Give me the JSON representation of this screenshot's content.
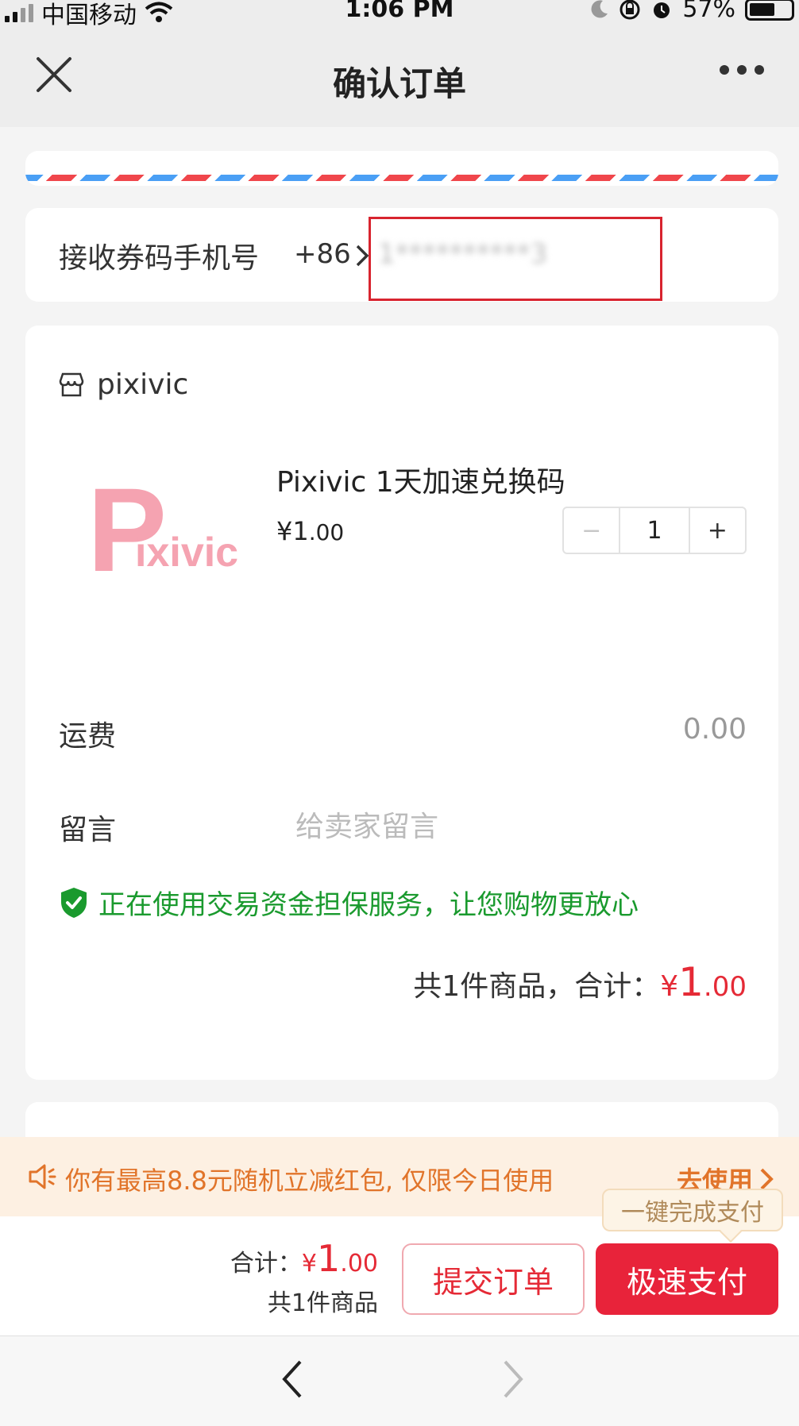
{
  "status_bar": {
    "carrier": "中国移动",
    "time": "1:06 PM",
    "battery": "57%",
    "icons": [
      "signal-icon",
      "wifi-icon",
      "moon-icon",
      "rotation-lock-icon",
      "alarm-icon",
      "battery-icon"
    ]
  },
  "nav": {
    "title": "确认订单",
    "close_icon": "close-icon",
    "more_icon": "more-icon"
  },
  "phone": {
    "label": "接收券码手机号",
    "country_code": "+86",
    "value": "1**********3"
  },
  "shop": {
    "name": "pixivic",
    "icon": "store-icon"
  },
  "product": {
    "title": "Pixivic 1天加速兑换码",
    "price_symbol": "¥",
    "price_int": "1",
    "price_dec": ".00",
    "logo_text_p": "P",
    "logo_text_rest": "ixivic",
    "quantity": "1",
    "minus": "−",
    "plus": "+"
  },
  "shipping": {
    "label": "运费",
    "value": "0.00"
  },
  "message": {
    "label": "留言",
    "placeholder": "给卖家留言"
  },
  "guarantee": {
    "text": "正在使用交易资金担保服务，让您购物更放心",
    "icon": "shield-check-icon"
  },
  "summary": {
    "prefix": "共1件商品，合计：",
    "currency": "¥",
    "amount_int": "1",
    "amount_dec": ".00"
  },
  "promo": {
    "text": "你有最高8.8元随机立减红包, 仅限今日使用",
    "action": "去使用",
    "icon": "speaker-icon"
  },
  "tooltip": {
    "text": "一键完成支付"
  },
  "bottom": {
    "total_label": "合计：",
    "currency": "¥",
    "amount_int": "1",
    "amount_dec": ".00",
    "count": "共1件商品",
    "submit": "提交订单",
    "pay": "极速支付"
  },
  "colors": {
    "accent_red": "#e8233a",
    "promo_orange": "#e1742a",
    "guarantee_green": "#1a9a2e"
  }
}
